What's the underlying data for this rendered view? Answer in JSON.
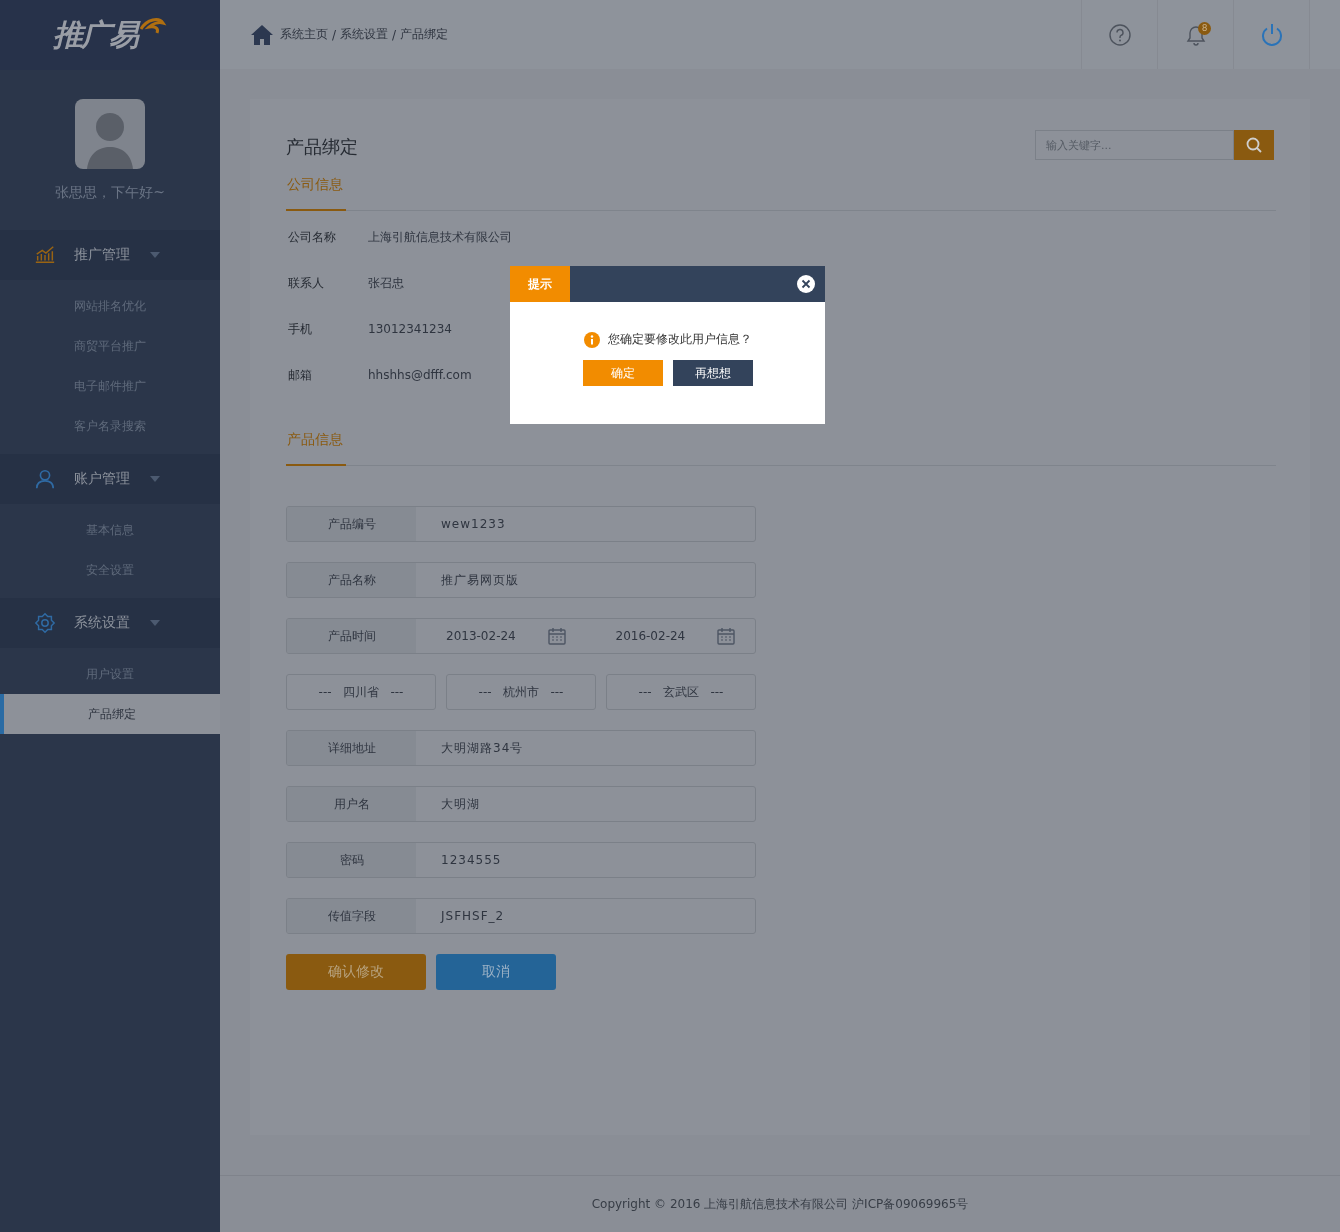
{
  "logo": {
    "text": "推广易"
  },
  "user": {
    "greeting": "张思思，下午好~"
  },
  "nav": [
    {
      "label": "推广管理",
      "kind": "chart",
      "children": [
        {
          "label": "网站排名优化",
          "selected": false
        },
        {
          "label": "商贸平台推广",
          "selected": false
        },
        {
          "label": "电子邮件推广",
          "selected": false
        },
        {
          "label": "客户名录搜索",
          "selected": false
        }
      ]
    },
    {
      "label": "账户管理",
      "kind": "user",
      "children": [
        {
          "label": "基本信息",
          "selected": false
        },
        {
          "label": "安全设置",
          "selected": false
        }
      ]
    },
    {
      "label": "系统设置",
      "kind": "gear",
      "children": [
        {
          "label": "用户设置",
          "selected": false
        },
        {
          "label": "产品绑定",
          "selected": true
        }
      ]
    }
  ],
  "breadcrumb": [
    "系统主页",
    "系统设置",
    "产品绑定"
  ],
  "breadcrumb_separator": "/",
  "header_actions": [
    {
      "kind": "help"
    },
    {
      "kind": "bell",
      "badge": "8"
    },
    {
      "kind": "power"
    }
  ],
  "page": {
    "title": "产品绑定",
    "search": {
      "placeholder": "输入关键字..."
    },
    "company": {
      "heading": "公司信息",
      "rows": [
        {
          "label": "公司名称",
          "value": "上海引航信息技术有限公司"
        },
        {
          "label": "联系人",
          "value": "张召忠"
        },
        {
          "label": "手机",
          "value": "13012341234"
        },
        {
          "label": "邮箱",
          "value": "hhshhs@dfff.com"
        }
      ]
    },
    "product": {
      "heading": "产品信息",
      "rows": [
        {
          "kind": "text",
          "label": "产品编号",
          "value": "wew1233"
        },
        {
          "kind": "text",
          "label": "产品名称",
          "value": "推广易网页版"
        },
        {
          "kind": "date_range",
          "label": "产品时间",
          "start": "2013-02-24",
          "end": "2016-02-24"
        },
        {
          "kind": "selects",
          "options": [
            "---   四川省   ---",
            "---   杭州市   ---",
            "---   玄武区   ---"
          ]
        },
        {
          "kind": "text",
          "label": "详细地址",
          "value": "大明湖路34号"
        },
        {
          "kind": "text",
          "label": "用户名",
          "value": "大明湖"
        },
        {
          "kind": "text",
          "label": "密码",
          "value": "1234555"
        },
        {
          "kind": "text",
          "label": "传值字段",
          "value": "JSFHSF_2"
        }
      ]
    },
    "buttons": [
      {
        "label": "确认修改",
        "kind": "primary"
      },
      {
        "label": "取消",
        "kind": "secondary"
      }
    ]
  },
  "dialog": {
    "title": "提示",
    "message": "您确定要修改此用户信息？",
    "buttons": [
      {
        "label": "确定",
        "kind": "primary"
      },
      {
        "label": "再想想",
        "kind": "secondary"
      }
    ]
  },
  "footer": "Copyright © 2016 上海引航信息技术有限公司  沪ICP备09069965号"
}
